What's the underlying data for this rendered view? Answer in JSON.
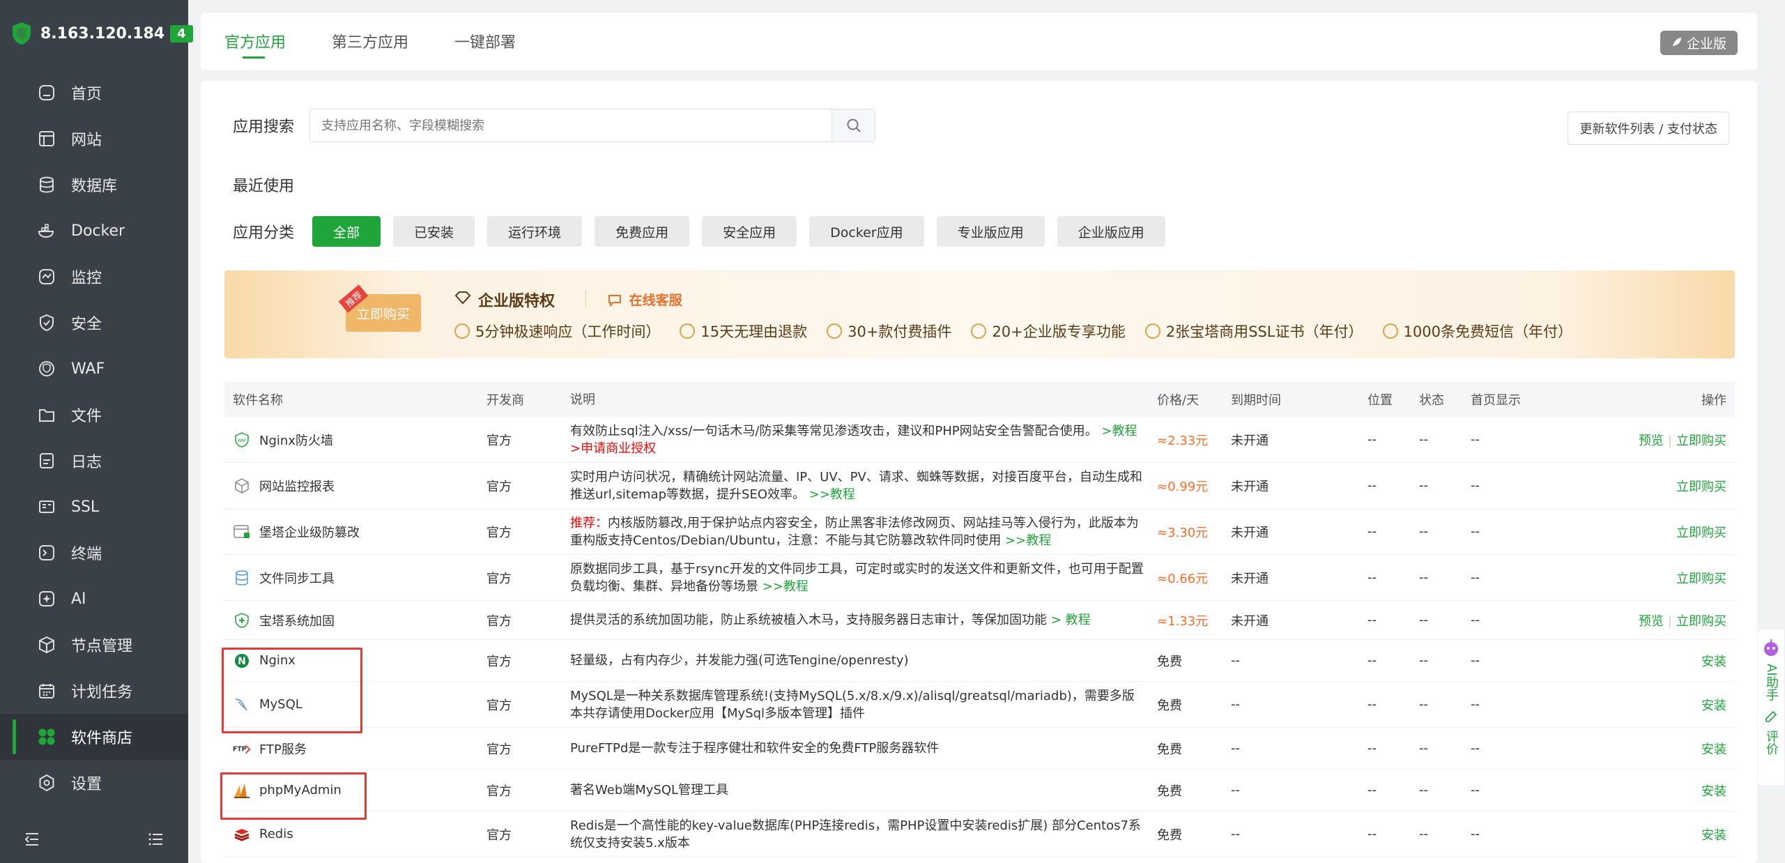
{
  "server": {
    "ip": "8.163.120.184",
    "badge": "4"
  },
  "nav": [
    {
      "label": "首页",
      "icon": "home-icon"
    },
    {
      "label": "网站",
      "icon": "website-icon"
    },
    {
      "label": "数据库",
      "icon": "database-icon"
    },
    {
      "label": "Docker",
      "icon": "docker-icon"
    },
    {
      "label": "监控",
      "icon": "monitor-icon"
    },
    {
      "label": "安全",
      "icon": "shield-check-icon"
    },
    {
      "label": "WAF",
      "icon": "waf-icon"
    },
    {
      "label": "文件",
      "icon": "folder-icon"
    },
    {
      "label": "日志",
      "icon": "log-icon"
    },
    {
      "label": "SSL",
      "icon": "ssl-icon"
    },
    {
      "label": "终端",
      "icon": "terminal-icon"
    },
    {
      "label": "AI",
      "icon": "ai-icon"
    },
    {
      "label": "节点管理",
      "icon": "node-icon"
    },
    {
      "label": "计划任务",
      "icon": "calendar-icon"
    },
    {
      "label": "软件商店",
      "icon": "app-store-icon"
    },
    {
      "label": "设置",
      "icon": "settings-icon"
    }
  ],
  "tabs": [
    "官方应用",
    "第三方应用",
    "一键部署"
  ],
  "enterprise_btn": "企业版",
  "search": {
    "label": "应用搜索",
    "placeholder": "支持应用名称、字段模糊搜索"
  },
  "update_btn": "更新软件列表 / 支付状态",
  "recent_label": "最近使用",
  "category": {
    "label": "应用分类",
    "items": [
      "全部",
      "已安装",
      "运行环境",
      "免费应用",
      "安全应用",
      "Docker应用",
      "专业版应用",
      "企业版应用"
    ]
  },
  "banner": {
    "tag": "推荐",
    "buy": "立即购买",
    "title": "企业版特权",
    "service": "在线客服",
    "perks": [
      "5分钟极速响应（工作时间）",
      "15天无理由退款",
      "30+款付费插件",
      "20+企业版专享功能",
      "2张宝塔商用SSL证书（年付）",
      "1000条免费短信（年付）"
    ]
  },
  "table": {
    "headers": [
      "软件名称",
      "开发商",
      "说明",
      "价格/天",
      "到期时间",
      "位置",
      "状态",
      "首页显示",
      "操作"
    ],
    "rows": [
      {
        "name": "Nginx防火墙",
        "dev": "官方",
        "desc": "有效防止sql注入/xss/一句话木马/防采集等常见渗透攻击，建议和PHP网站安全告警配合使用。",
        "desc_link": ">教程",
        "desc_link2": ">申请商业授权",
        "price": "≈2.33元",
        "exp": "未开通",
        "pos": "--",
        "st": "--",
        "home": "--",
        "op1": "预览",
        "op2": "立即购买"
      },
      {
        "name": "网站监控报表",
        "dev": "官方",
        "desc": "实时用户访问状况，精确统计网站流量、IP、UV、PV、请求、蜘蛛等数据，对接百度平台，自动生成和推送url,sitemap等数据，提升SEO效率。",
        "desc_link": ">>教程",
        "price": "≈0.99元",
        "exp": "未开通",
        "pos": "--",
        "st": "--",
        "home": "--",
        "op2": "立即购买"
      },
      {
        "name": "堡塔企业级防篡改",
        "dev": "官方",
        "desc_prefix": "推荐：",
        "desc": "内核版防篡改,用于保护站点内容安全，防止黑客非法修改网页、网站挂马等入侵行为，此版本为重构版支持Centos/Debian/Ubuntu，注意：不能与其它防篡改软件同时使用",
        "desc_link": ">>教程",
        "price": "≈3.30元",
        "exp": "未开通",
        "pos": "--",
        "st": "--",
        "home": "--",
        "op2": "立即购买"
      },
      {
        "name": "文件同步工具",
        "dev": "官方",
        "desc": "原数据同步工具，基于rsync开发的文件同步工具，可定时或实时的发送文件和更新文件，也可用于配置负载均衡、集群、异地备份等场景",
        "desc_link": ">>教程",
        "price": "≈0.66元",
        "exp": "未开通",
        "pos": "--",
        "st": "--",
        "home": "--",
        "op2": "立即购买"
      },
      {
        "name": "宝塔系统加固",
        "dev": "官方",
        "desc": "提供灵活的系统加固功能，防止系统被植入木马，支持服务器日志审计，等保加固功能",
        "desc_link": "> 教程",
        "price": "≈1.33元",
        "exp": "未开通",
        "pos": "--",
        "st": "--",
        "home": "--",
        "op1": "预览",
        "op2": "立即购买"
      },
      {
        "name": "Nginx",
        "dev": "官方",
        "desc": "轻量级，占有内存少，并发能力强(可选Tengine/openresty)",
        "price": "免费",
        "exp": "--",
        "pos": "--",
        "st": "--",
        "home": "--",
        "op2": "安装"
      },
      {
        "name": "MySQL",
        "dev": "官方",
        "desc": "MySQL是一种关系数据库管理系统!(支持MySQL(5.x/8.x/9.x)/alisql/greatsql/mariadb)，需要多版本共存请使用Docker应用【MySql多版本管理】插件",
        "price": "免费",
        "exp": "--",
        "pos": "--",
        "st": "--",
        "home": "--",
        "op2": "安装"
      },
      {
        "name": "FTP服务",
        "dev": "官方",
        "desc": "PureFTPd是一款专注于程序健壮和软件安全的免费FTP服务器软件",
        "price": "免费",
        "exp": "--",
        "pos": "--",
        "st": "--",
        "home": "--",
        "op2": "安装"
      },
      {
        "name": "phpMyAdmin",
        "dev": "官方",
        "desc": "著名Web端MySQL管理工具",
        "price": "免费",
        "exp": "--",
        "pos": "--",
        "st": "--",
        "home": "--",
        "op2": "安装"
      },
      {
        "name": "Redis",
        "dev": "官方",
        "desc": "Redis是一个高性能的key-value数据库(PHP连接redis，需PHP设置中安装redis扩展) 部分Centos7系统仅支持安装5.x版本",
        "price": "免费",
        "exp": "--",
        "pos": "--",
        "st": "--",
        "home": "--",
        "op2": "安装"
      }
    ]
  },
  "ai_float": {
    "a": "AI助手",
    "b": "评价"
  },
  "colors": {
    "brand": "#20a53a",
    "sidebar": "#3a4047",
    "paid_price": "#fc6d26",
    "highlight": "#e53935"
  }
}
